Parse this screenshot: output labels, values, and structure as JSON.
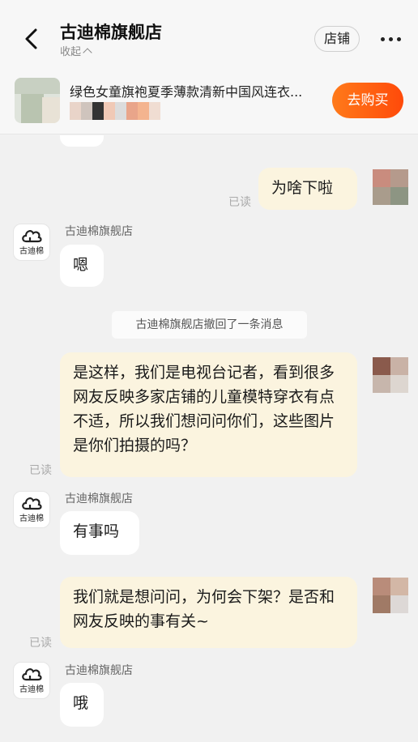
{
  "header": {
    "title": "古迪棉旗舰店",
    "collapse_label": "收起",
    "store_label": "店铺"
  },
  "product": {
    "name": "绿色女童旗袍夏季薄款清新中国风连衣...",
    "buy_label": "去购买"
  },
  "shop_avatar_text": "古迪棉",
  "colors": {
    "buy_button": "#ff5a0e",
    "outgoing_bubble": "#fbf4df",
    "incoming_bubble": "#ffffff",
    "background": "#f1f1f1"
  },
  "messages": [
    {
      "direction": "out",
      "text": "为啥下啦",
      "status": "已读"
    },
    {
      "direction": "in",
      "sender": "古迪棉旗舰店",
      "text": "嗯"
    },
    {
      "direction": "system",
      "text": "古迪棉旗舰店撤回了一条消息"
    },
    {
      "direction": "out",
      "text": "是这样，我们是电视台记者，看到很多网友反映多家店铺的儿童模特穿衣有点不适，所以我们想问问你们，这些图片是你们拍摄的吗？",
      "status": "已读"
    },
    {
      "direction": "in",
      "sender": "古迪棉旗舰店",
      "text": "有事吗"
    },
    {
      "direction": "out",
      "text": "我们就是想问问，为何会下架？是否和网友反映的事有关~",
      "status": "已读"
    },
    {
      "direction": "in",
      "sender": "古迪棉旗舰店",
      "text": "哦"
    }
  ]
}
